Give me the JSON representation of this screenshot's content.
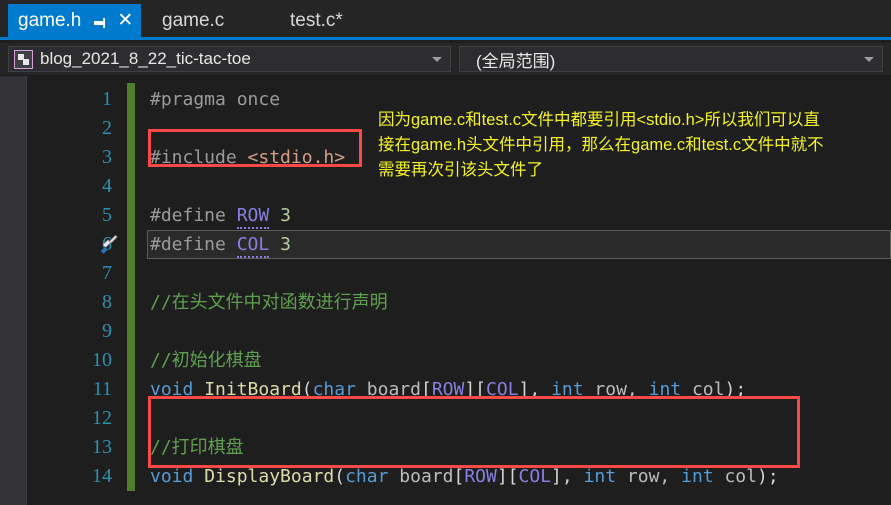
{
  "window": {
    "accent_blue": "#007acc",
    "bg": "#1e1e1e",
    "chrome_bg": "#252526"
  },
  "tabs": {
    "items": [
      {
        "label": "game.h",
        "active": true,
        "modified": false,
        "pin_icon": "pin-icon",
        "close_icon": "close-icon"
      },
      {
        "label": "game.c",
        "active": false,
        "modified": false
      },
      {
        "label": "test.c*",
        "active": false,
        "modified": true
      }
    ]
  },
  "navbar": {
    "scope_icon": "namespace-icon",
    "project_scope": "blog_2021_8_22_tic-tac-toe",
    "member_scope": "(全局范围)",
    "dropdown_icon": "chevron-down-icon"
  },
  "editor": {
    "language": "C/C++",
    "filename": "game.h",
    "current_line": 6,
    "bookmark_icon": "brush-icon",
    "changebar_color": "#4e7d2b",
    "lineno_color": "#2b91af",
    "lines": [
      {
        "no": "1",
        "tokens": [
          {
            "t": "#pragma once",
            "c": "t-pre"
          }
        ]
      },
      {
        "no": "2",
        "tokens": []
      },
      {
        "no": "3",
        "tokens": [
          {
            "t": "#include ",
            "c": "t-pre"
          },
          {
            "t": "<stdio.h>",
            "c": "t-str"
          }
        ]
      },
      {
        "no": "4",
        "tokens": []
      },
      {
        "no": "5",
        "tokens": [
          {
            "t": "#define ",
            "c": "t-pre"
          },
          {
            "t": "ROW",
            "c": "t-macro dotted"
          },
          {
            "t": " ",
            "c": "t-plain"
          },
          {
            "t": "3",
            "c": "t-num"
          }
        ]
      },
      {
        "no": "6",
        "tokens": [
          {
            "t": "#define ",
            "c": "t-pre"
          },
          {
            "t": "COL",
            "c": "t-macro dotted"
          },
          {
            "t": " ",
            "c": "t-plain"
          },
          {
            "t": "3",
            "c": "t-num"
          }
        ]
      },
      {
        "no": "7",
        "tokens": []
      },
      {
        "no": "8",
        "tokens": [
          {
            "t": "//在头文件中对函数进行声明",
            "c": "t-cmt"
          }
        ]
      },
      {
        "no": "9",
        "tokens": []
      },
      {
        "no": "10",
        "tokens": [
          {
            "t": "//初始化棋盘",
            "c": "t-cmt"
          }
        ]
      },
      {
        "no": "11",
        "tokens": [
          {
            "t": "void",
            "c": "t-kw"
          },
          {
            "t": " ",
            "c": "t-plain"
          },
          {
            "t": "InitBoard",
            "c": "t-fn"
          },
          {
            "t": "(",
            "c": "t-punct"
          },
          {
            "t": "char",
            "c": "t-kw"
          },
          {
            "t": " ",
            "c": "t-plain"
          },
          {
            "t": "board",
            "c": "t-plain"
          },
          {
            "t": "[",
            "c": "t-punct"
          },
          {
            "t": "ROW",
            "c": "t-macro"
          },
          {
            "t": "][",
            "c": "t-punct"
          },
          {
            "t": "COL",
            "c": "t-macro"
          },
          {
            "t": "], ",
            "c": "t-punct"
          },
          {
            "t": "int",
            "c": "t-kw"
          },
          {
            "t": " row, ",
            "c": "t-plain"
          },
          {
            "t": "int",
            "c": "t-kw"
          },
          {
            "t": " col",
            "c": "t-plain"
          },
          {
            "t": ");",
            "c": "t-punct"
          }
        ]
      },
      {
        "no": "12",
        "tokens": []
      },
      {
        "no": "13",
        "tokens": [
          {
            "t": "//打印棋盘",
            "c": "t-cmt"
          }
        ]
      },
      {
        "no": "14",
        "tokens": [
          {
            "t": "void",
            "c": "t-kw"
          },
          {
            "t": " ",
            "c": "t-plain"
          },
          {
            "t": "DisplayBoard",
            "c": "t-fn"
          },
          {
            "t": "(",
            "c": "t-punct"
          },
          {
            "t": "char",
            "c": "t-kw"
          },
          {
            "t": " ",
            "c": "t-plain"
          },
          {
            "t": "board",
            "c": "t-plain"
          },
          {
            "t": "[",
            "c": "t-punct"
          },
          {
            "t": "ROW",
            "c": "t-macro"
          },
          {
            "t": "][",
            "c": "t-punct"
          },
          {
            "t": "COL",
            "c": "t-macro"
          },
          {
            "t": "], ",
            "c": "t-punct"
          },
          {
            "t": "int",
            "c": "t-kw"
          },
          {
            "t": " row, ",
            "c": "t-plain"
          },
          {
            "t": "int",
            "c": "t-kw"
          },
          {
            "t": " col",
            "c": "t-plain"
          },
          {
            "t": ");",
            "c": "t-punct"
          }
        ]
      }
    ]
  },
  "annotations": {
    "highlight_color": "#fb4a46",
    "note_color": "#f4f425",
    "note_lines": [
      "因为game.c和test.c文件中都要引用<stdio.h>所以我们可以直",
      "接在game.h头文件中引用，那么在game.c和test.c文件中就不",
      "需要再次引该头文件了"
    ],
    "boxes": [
      {
        "name": "include-highlight",
        "target_line": "3"
      },
      {
        "name": "display-board-highlight",
        "target_lines": "13-14"
      }
    ]
  }
}
